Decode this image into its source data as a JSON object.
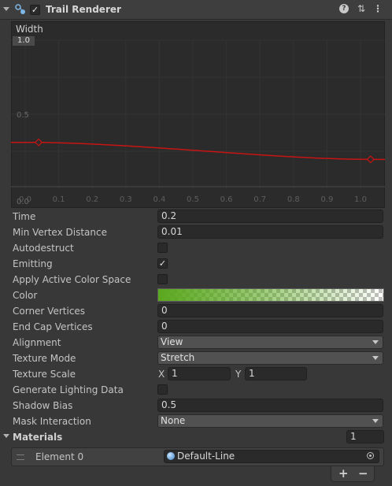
{
  "header": {
    "title": "Trail Renderer",
    "enabled_check": "✓",
    "help_icon": "?",
    "settings_icon": "⇅",
    "menu_icon": "⋮"
  },
  "curve": {
    "label": "Width",
    "max_tag": "1.0",
    "y_ticks": [
      "0.5",
      "0.0"
    ],
    "x_ticks": [
      "0.0",
      "0.1",
      "0.2",
      "0.3",
      "0.4",
      "0.5",
      "0.6",
      "0.7",
      "0.8",
      "0.9",
      "1.0"
    ],
    "line_color": "#c81414"
  },
  "properties": {
    "time": {
      "label": "Time",
      "value": "0.2"
    },
    "min_vertex_distance": {
      "label": "Min Vertex Distance",
      "value": "0.01"
    },
    "autodestruct": {
      "label": "Autodestruct",
      "checked": ""
    },
    "emitting": {
      "label": "Emitting",
      "checked": "✓"
    },
    "apply_active_color_space": {
      "label": "Apply Active Color Space",
      "checked": ""
    },
    "color": {
      "label": "Color",
      "start_color": "#5aa81e"
    },
    "corner_vertices": {
      "label": "Corner Vertices",
      "value": "0"
    },
    "end_cap_vertices": {
      "label": "End Cap Vertices",
      "value": "0"
    },
    "alignment": {
      "label": "Alignment",
      "value": "View"
    },
    "texture_mode": {
      "label": "Texture Mode",
      "value": "Stretch"
    },
    "texture_scale": {
      "label": "Texture Scale",
      "x_label": "X",
      "x_value": "1",
      "y_label": "Y",
      "y_value": "1"
    },
    "generate_lighting_data": {
      "label": "Generate Lighting Data",
      "checked": ""
    },
    "shadow_bias": {
      "label": "Shadow Bias",
      "value": "0.5"
    },
    "mask_interaction": {
      "label": "Mask Interaction",
      "value": "None"
    }
  },
  "materials": {
    "label": "Materials",
    "count": "1",
    "elements": [
      {
        "label": "Element 0",
        "value": "Default-Line"
      }
    ],
    "add_label": "+",
    "remove_label": "−"
  }
}
